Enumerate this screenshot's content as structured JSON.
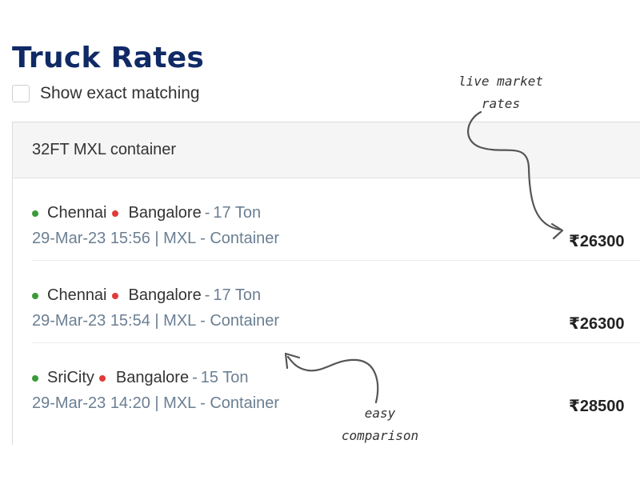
{
  "header": {
    "title": "Truck Rates"
  },
  "filter": {
    "exact_label": "Show exact matching",
    "checked": false
  },
  "card": {
    "header_label": "32FT MXL container",
    "rows": [
      {
        "from": "Chennai",
        "to": "Bangalore",
        "weight": "17 Ton",
        "meta": "29-Mar-23 15:56 | MXL - Container",
        "price": "₹26300"
      },
      {
        "from": "Chennai",
        "to": "Bangalore",
        "weight": "17 Ton",
        "meta": "29-Mar-23 15:54 | MXL - Container",
        "price": "₹26300"
      },
      {
        "from": "SriCity",
        "to": "Bangalore",
        "weight": "15 Ton",
        "meta": "29-Mar-23 14:20 | MXL - Container",
        "price": "₹28500"
      }
    ]
  },
  "annotations": {
    "live_line1": "live market",
    "live_line2": "rates",
    "easy_line1": "easy",
    "easy_line2": "comparison"
  },
  "colors": {
    "title": "#102a66",
    "origin_dot": "#3a9a3a",
    "destination_dot": "#e03a3a",
    "meta_text": "#6b7f93"
  }
}
